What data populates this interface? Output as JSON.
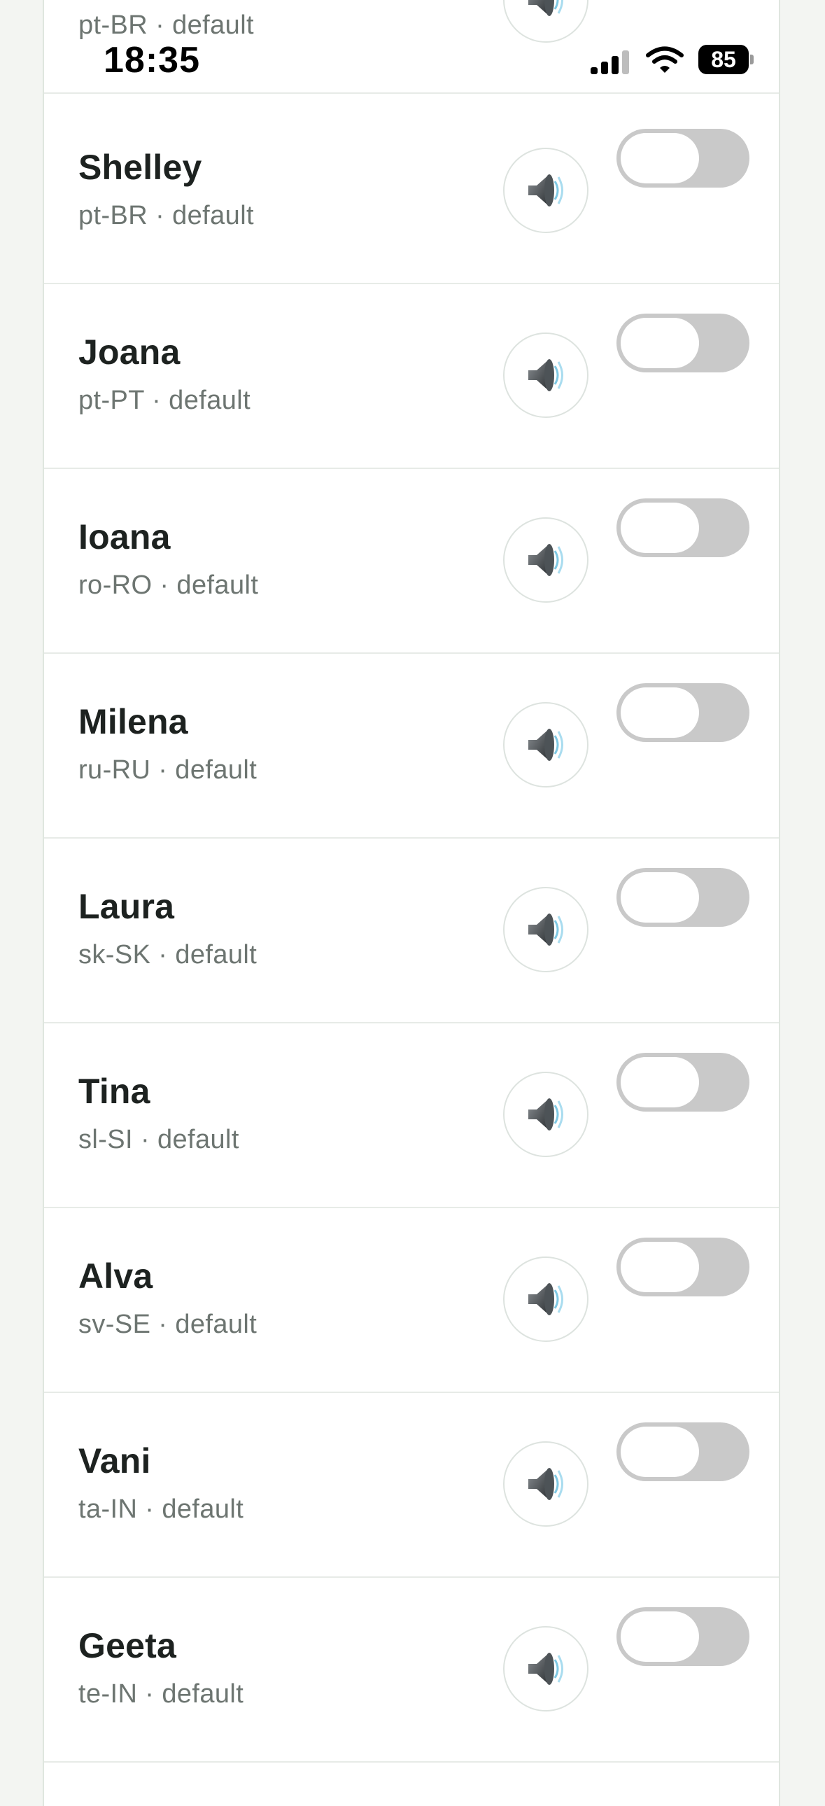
{
  "status_bar": {
    "time": "18:35",
    "battery": "85",
    "icons": [
      "cellular-signal-icon",
      "wifi-icon",
      "battery-icon"
    ]
  },
  "voices": [
    {
      "name": "",
      "locale": "pt-BR · default",
      "enabled": false
    },
    {
      "name": "Shelley",
      "locale": "pt-BR · default",
      "enabled": false
    },
    {
      "name": "Joana",
      "locale": "pt-PT · default",
      "enabled": false
    },
    {
      "name": "Ioana",
      "locale": "ro-RO · default",
      "enabled": false
    },
    {
      "name": "Milena",
      "locale": "ru-RU · default",
      "enabled": false
    },
    {
      "name": "Laura",
      "locale": "sk-SK · default",
      "enabled": false
    },
    {
      "name": "Tina",
      "locale": "sl-SI · default",
      "enabled": false
    },
    {
      "name": "Alva",
      "locale": "sv-SE · default",
      "enabled": false
    },
    {
      "name": "Vani",
      "locale": "ta-IN · default",
      "enabled": false
    },
    {
      "name": "Geeta",
      "locale": "te-IN · default",
      "enabled": false
    }
  ],
  "row_icon": "speaker-icon",
  "colors": {
    "background": "#f3f5f2",
    "card": "#ffffff",
    "toggle_off": "#c9c9c9",
    "text_primary": "#1d2220",
    "text_secondary": "#6d7571"
  }
}
